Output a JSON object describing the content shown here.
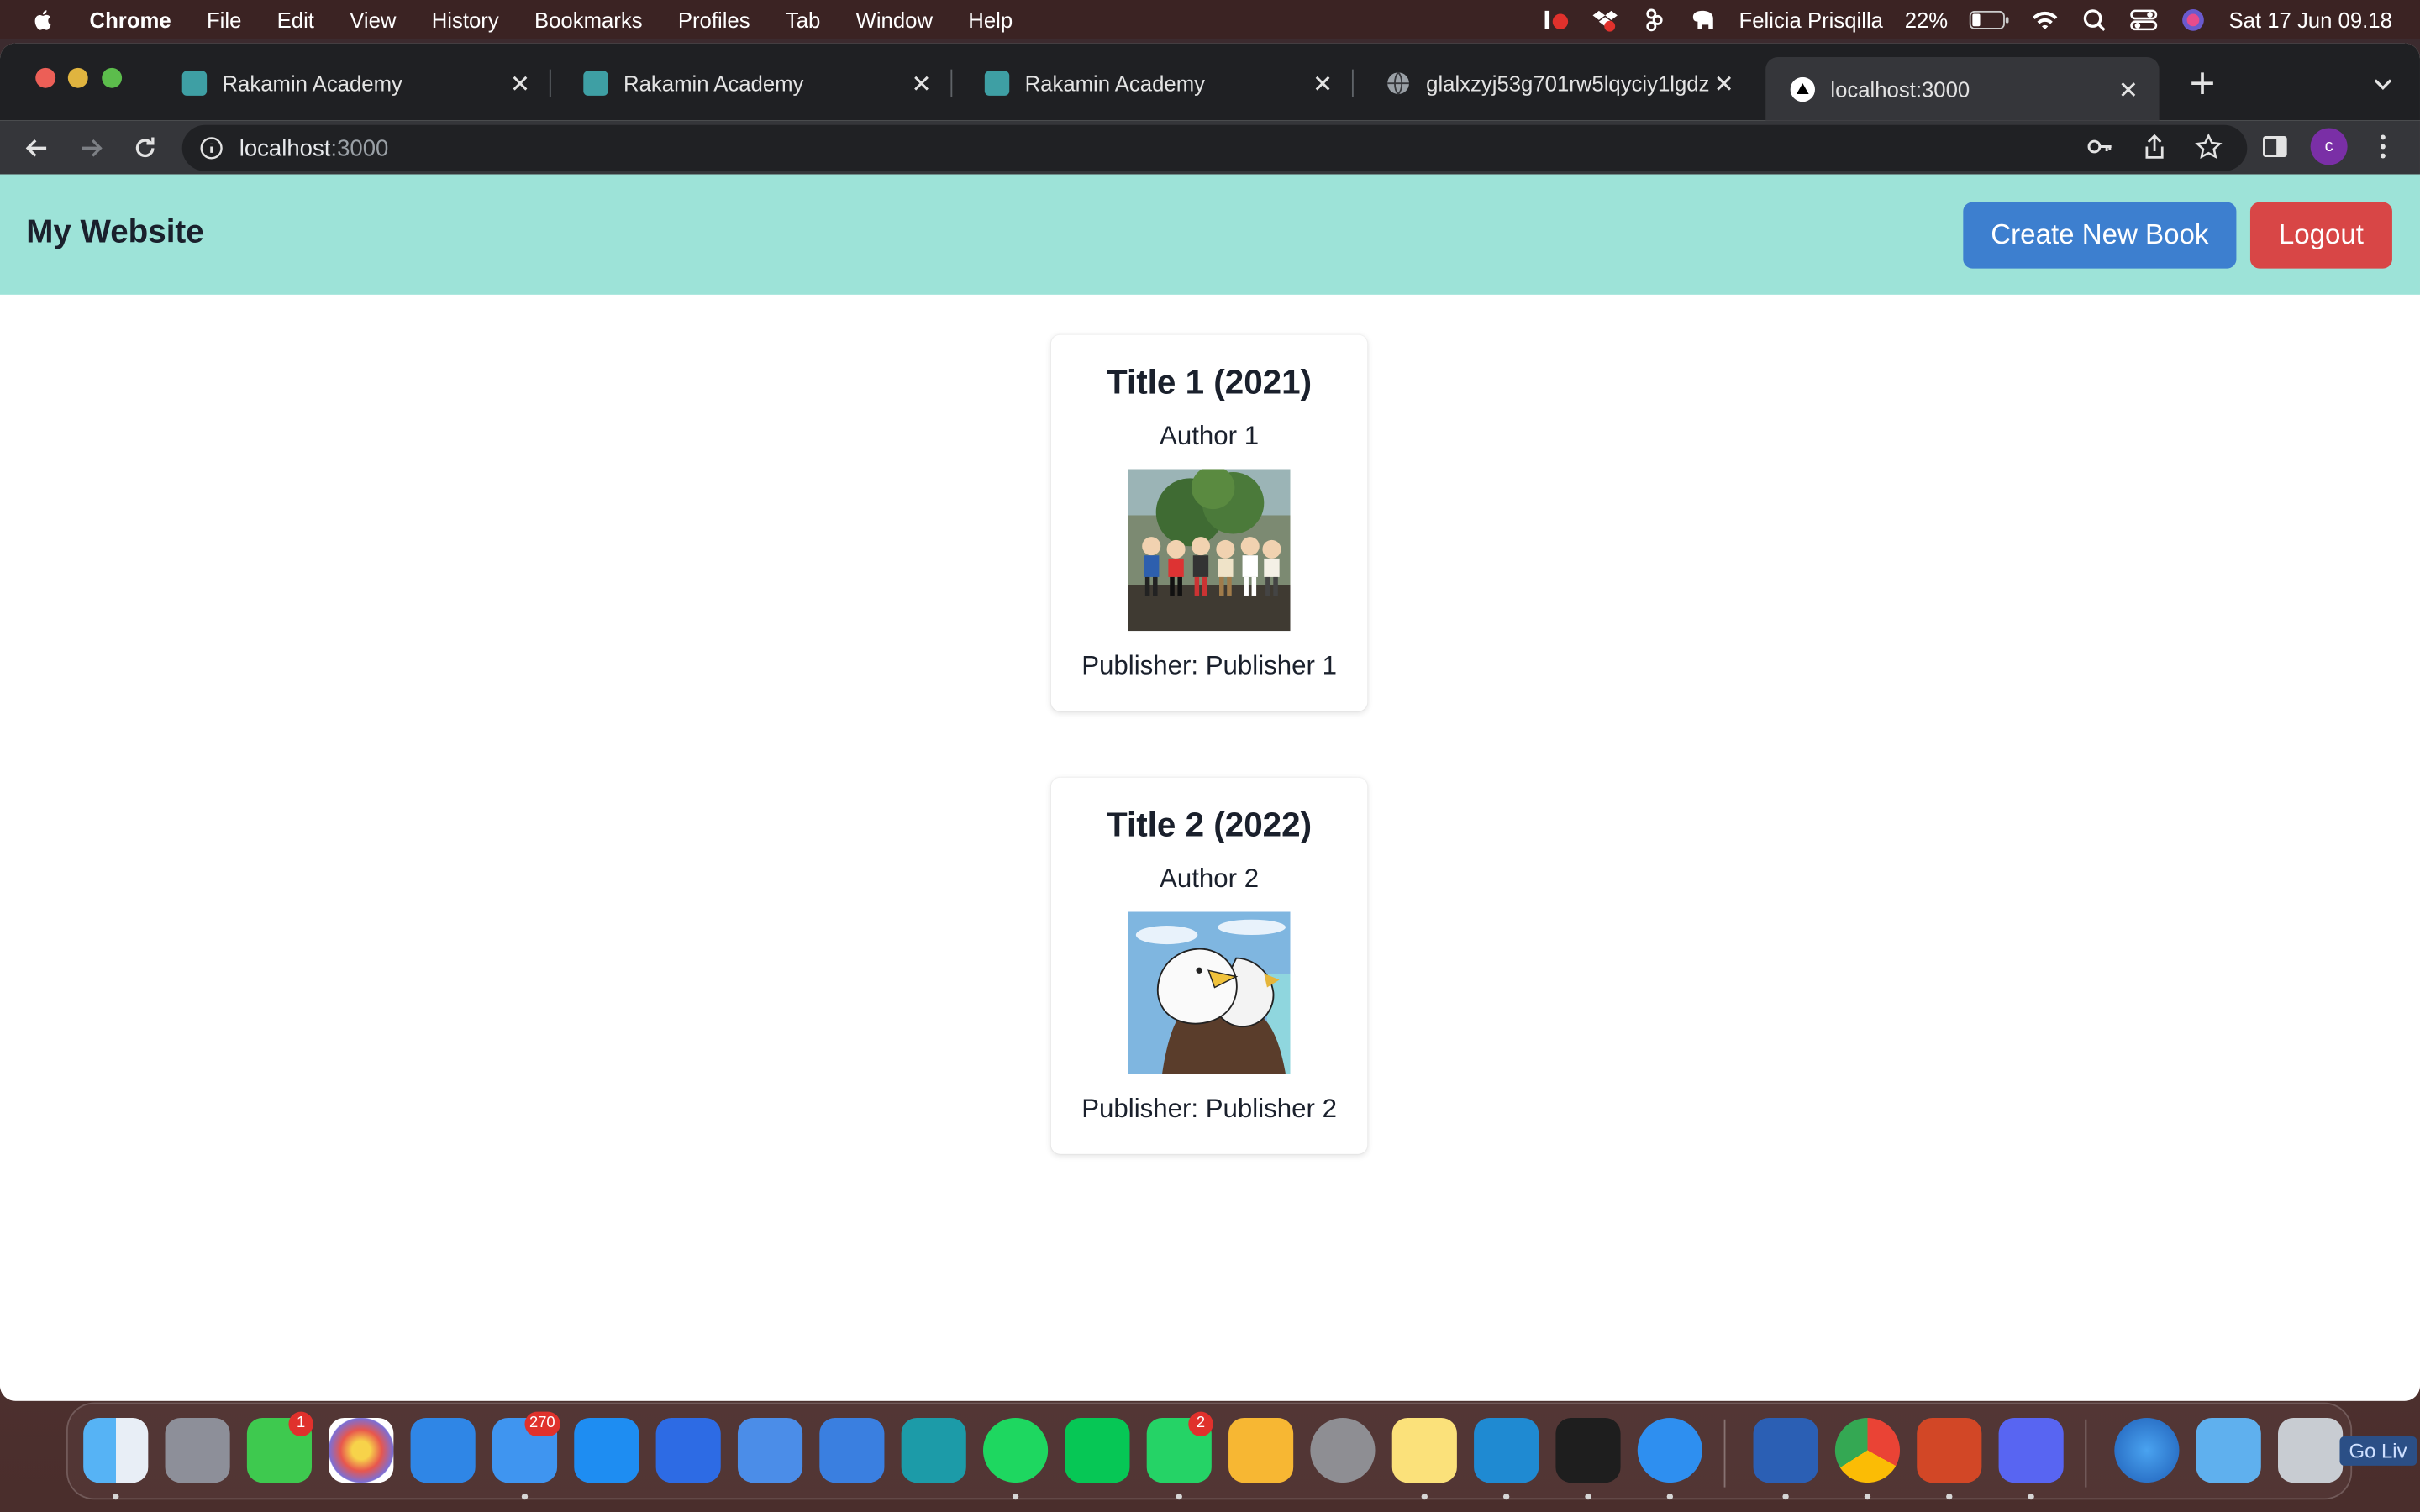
{
  "menubar": {
    "app_name": "Chrome",
    "items": [
      "File",
      "Edit",
      "View",
      "History",
      "Bookmarks",
      "Profiles",
      "Tab",
      "Window",
      "Help"
    ],
    "user_name": "Felicia Prisqilla",
    "battery_percent": "22%",
    "datetime": "Sat 17 Jun  09.18"
  },
  "browser": {
    "tabs": [
      {
        "label": "Rakamin Academy",
        "favicon": "rakamin-icon"
      },
      {
        "label": "Rakamin Academy",
        "favicon": "rakamin-icon"
      },
      {
        "label": "Rakamin Academy",
        "favicon": "rakamin-icon"
      },
      {
        "label": "glalxzyj53g701rw5lqyciy1lgdz",
        "favicon": "globe-icon"
      },
      {
        "label": "localhost:3000",
        "favicon": "triangle-icon",
        "active": true
      }
    ],
    "address": {
      "host": "localhost",
      "port": ":3000"
    },
    "profile_initial": "c"
  },
  "page": {
    "brand": "My Website",
    "create_button": "Create New Book",
    "logout_button": "Logout",
    "books": [
      {
        "title": "Title 1 (2021)",
        "author": "Author 1",
        "publisher": "Publisher: Publisher 1",
        "image": "group-illustration"
      },
      {
        "title": "Title 2 (2022)",
        "author": "Author 2",
        "publisher": "Publisher: Publisher 2",
        "image": "eagle-illustration"
      }
    ]
  },
  "dock": {
    "badges": {
      "messages": "1",
      "mail": "270",
      "whatsapp": "2"
    },
    "golive_label": "Go Liv"
  },
  "colors": {
    "navbar": "#9de3d8",
    "create_button": "#3d7fcf",
    "logout_button": "#d84646"
  }
}
